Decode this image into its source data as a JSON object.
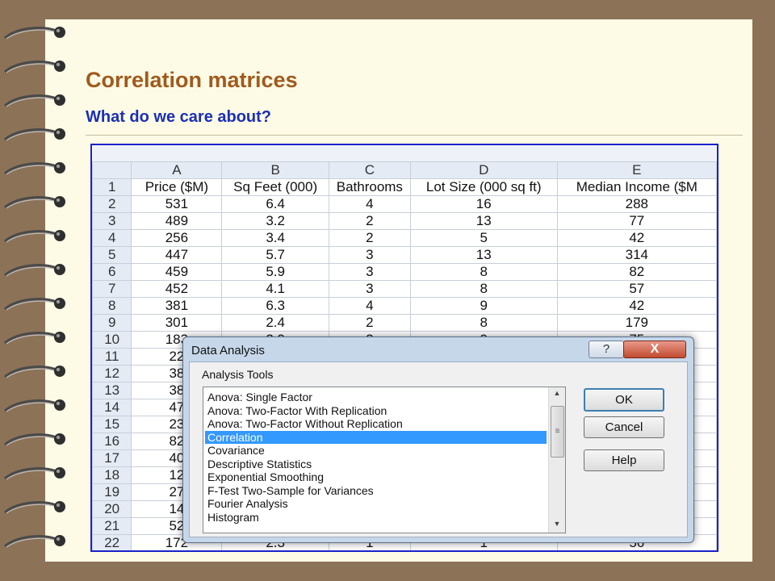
{
  "slide": {
    "title": "Correlation matrices",
    "subtitle": "What do we care about?"
  },
  "spreadsheet": {
    "columns": [
      "A",
      "B",
      "C",
      "D",
      "E"
    ],
    "header_row": {
      "num": "1",
      "cells": [
        "Price ($M)",
        "Sq Feet (000)",
        "Bathrooms",
        "Lot Size (000 sq ft)",
        "Median Income ($M"
      ]
    },
    "rows": [
      {
        "num": "2",
        "cells": [
          "531",
          "6.4",
          "4",
          "16",
          "288"
        ]
      },
      {
        "num": "3",
        "cells": [
          "489",
          "3.2",
          "2",
          "13",
          "77"
        ]
      },
      {
        "num": "4",
        "cells": [
          "256",
          "3.4",
          "2",
          "5",
          "42"
        ]
      },
      {
        "num": "5",
        "cells": [
          "447",
          "5.7",
          "3",
          "13",
          "314"
        ]
      },
      {
        "num": "6",
        "cells": [
          "459",
          "5.9",
          "3",
          "8",
          "82"
        ]
      },
      {
        "num": "7",
        "cells": [
          "452",
          "4.1",
          "3",
          "8",
          "57"
        ]
      },
      {
        "num": "8",
        "cells": [
          "381",
          "6.3",
          "4",
          "9",
          "42"
        ]
      },
      {
        "num": "9",
        "cells": [
          "301",
          "2.4",
          "2",
          "8",
          "179"
        ]
      },
      {
        "num": "10",
        "cells": [
          "183",
          "2.9",
          "2",
          "9",
          "75"
        ]
      },
      {
        "num": "11",
        "cells": [
          "22",
          "",
          "",
          "",
          ""
        ]
      },
      {
        "num": "12",
        "cells": [
          "38",
          "",
          "",
          "",
          ""
        ]
      },
      {
        "num": "13",
        "cells": [
          "38",
          "",
          "",
          "",
          ""
        ]
      },
      {
        "num": "14",
        "cells": [
          "47",
          "",
          "",
          "",
          ""
        ]
      },
      {
        "num": "15",
        "cells": [
          "23",
          "",
          "",
          "",
          ""
        ]
      },
      {
        "num": "16",
        "cells": [
          "82",
          "",
          "",
          "",
          ""
        ]
      },
      {
        "num": "17",
        "cells": [
          "40",
          "",
          "",
          "",
          ""
        ]
      },
      {
        "num": "18",
        "cells": [
          "12",
          "",
          "",
          "",
          ""
        ]
      },
      {
        "num": "19",
        "cells": [
          "27",
          "",
          "",
          "",
          ""
        ]
      },
      {
        "num": "20",
        "cells": [
          "14",
          "",
          "",
          "",
          ""
        ]
      },
      {
        "num": "21",
        "cells": [
          "52",
          "",
          "",
          "",
          ""
        ]
      },
      {
        "num": "22",
        "cells": [
          "172",
          "2.3",
          "1",
          "1",
          "56"
        ]
      }
    ]
  },
  "dialog": {
    "title": "Data Analysis",
    "help_label": "?",
    "close_label": "X",
    "analysis_tools_label": "Analysis Tools",
    "items": [
      "Anova: Single Factor",
      "Anova: Two-Factor With Replication",
      "Anova: Two-Factor Without Replication",
      "Correlation",
      "Covariance",
      "Descriptive Statistics",
      "Exponential Smoothing",
      "F-Test Two-Sample for Variances",
      "Fourier Analysis",
      "Histogram"
    ],
    "selected_item": "Correlation",
    "ok_label": "OK",
    "cancel_label": "Cancel",
    "help_button_label": "Help"
  },
  "colors": {
    "background": "#8c7257",
    "paper": "#fdfbe5",
    "title": "#a05a1f",
    "subtitle": "#1b2fb5",
    "screenshot_border": "#1a22c9",
    "selection": "#3399ff"
  }
}
